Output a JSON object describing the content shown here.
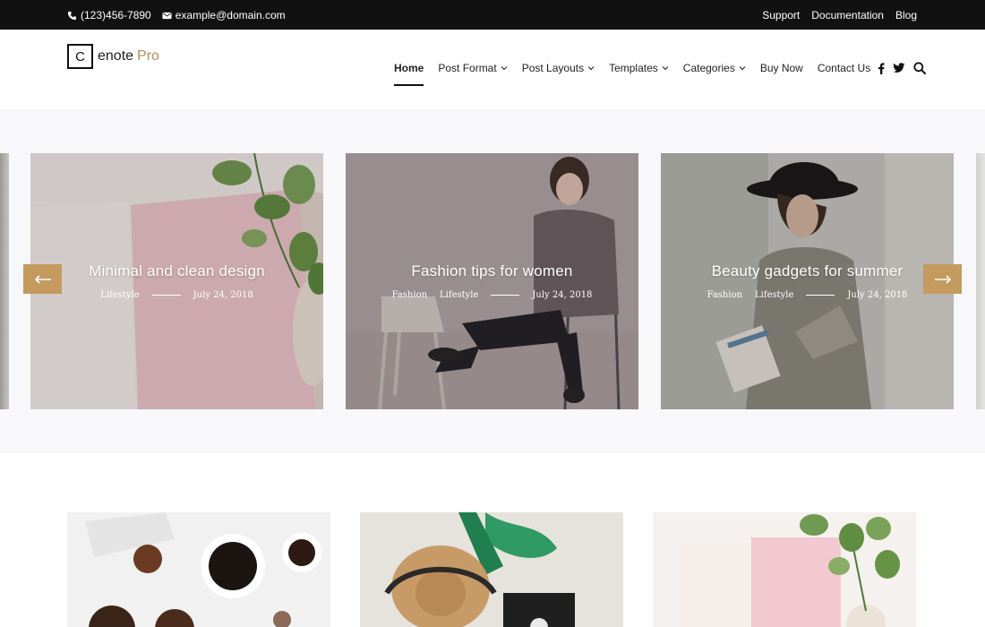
{
  "topbar": {
    "phone": "(123)456-7890",
    "email": "example@domain.com",
    "links": [
      "Support",
      "Documentation",
      "Blog"
    ]
  },
  "brand": {
    "letter": "C",
    "name": "enote",
    "suffix": "Pro",
    "accent": "#b58e4f"
  },
  "nav": {
    "items": [
      {
        "label": "Home",
        "dropdown": false,
        "active": true
      },
      {
        "label": "Post Format",
        "dropdown": true
      },
      {
        "label": "Post Layouts",
        "dropdown": true
      },
      {
        "label": "Templates",
        "dropdown": true
      },
      {
        "label": "Categories",
        "dropdown": true
      },
      {
        "label": "Buy Now",
        "dropdown": false
      },
      {
        "label": "Contact Us",
        "dropdown": false
      }
    ],
    "icons": [
      "facebook-icon",
      "twitter-icon",
      "search-icon"
    ]
  },
  "slider": {
    "slides": [
      {
        "title": "Minimal and clean design",
        "categories": [
          "Lifestyle"
        ],
        "date": "July 24, 2018"
      },
      {
        "title": "Fashion tips for women",
        "categories": [
          "Fashion",
          "Lifestyle"
        ],
        "date": "July 24, 2018"
      },
      {
        "title": "Beauty gadgets for summer",
        "categories": [
          "Fashion",
          "Lifestyle"
        ],
        "date": "July 24, 2018"
      }
    ],
    "prev_icon": "arrow-left-icon",
    "next_icon": "arrow-right-icon",
    "button_color": "#c49a5f"
  },
  "colors": {
    "topbar": "#111111",
    "slider_bg": "#f8f8fb"
  }
}
